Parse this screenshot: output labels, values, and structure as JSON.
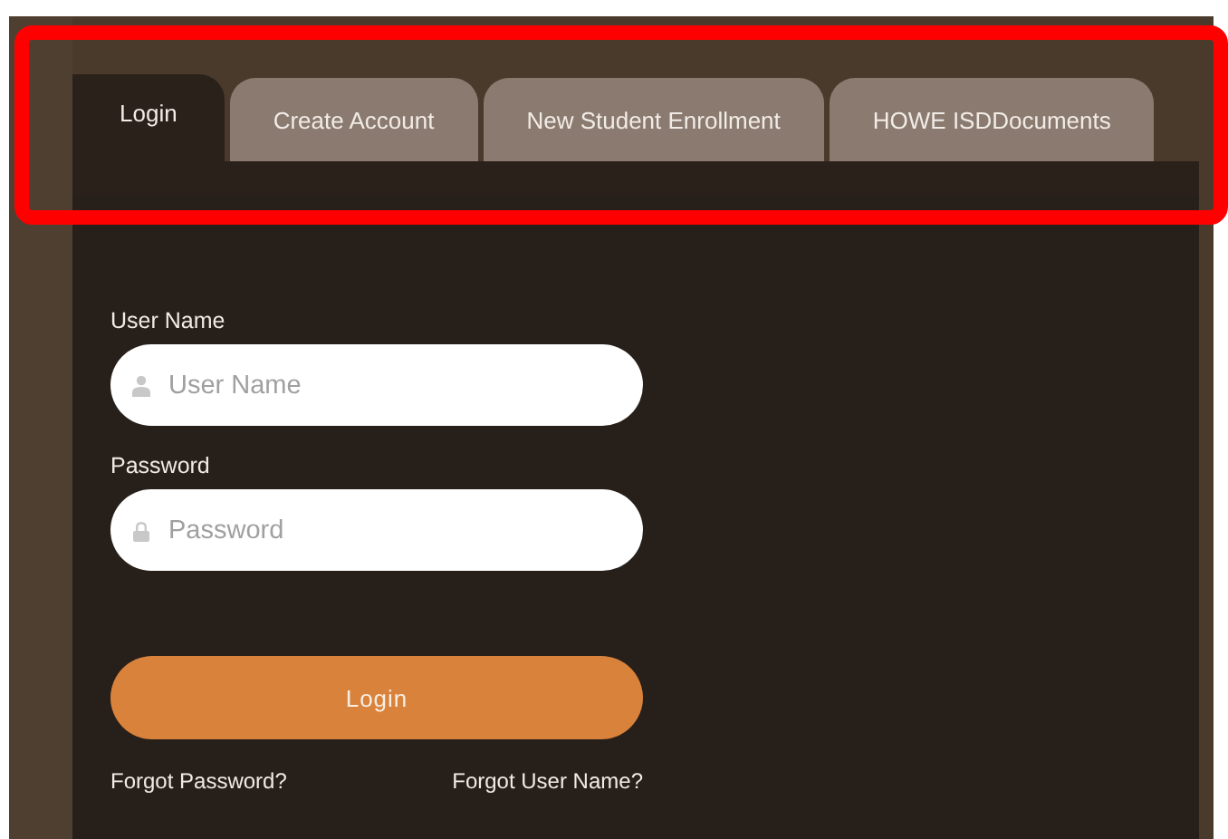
{
  "tabs": [
    {
      "label": "Login",
      "selected": true
    },
    {
      "label": "Create Account",
      "selected": false
    },
    {
      "label": "New Student Enrollment",
      "selected": false
    },
    {
      "label": "HOWE ISDDocuments",
      "selected": false
    }
  ],
  "form": {
    "fields": [
      {
        "label": "User Name",
        "placeholder": "User Name",
        "kind": "user"
      },
      {
        "label": "Password",
        "placeholder": "Password",
        "kind": "password"
      }
    ],
    "submit": "Login",
    "links": [
      "Forgot Password?",
      "Forgot User Name?"
    ]
  },
  "highlight": {
    "kind": "frame"
  }
}
